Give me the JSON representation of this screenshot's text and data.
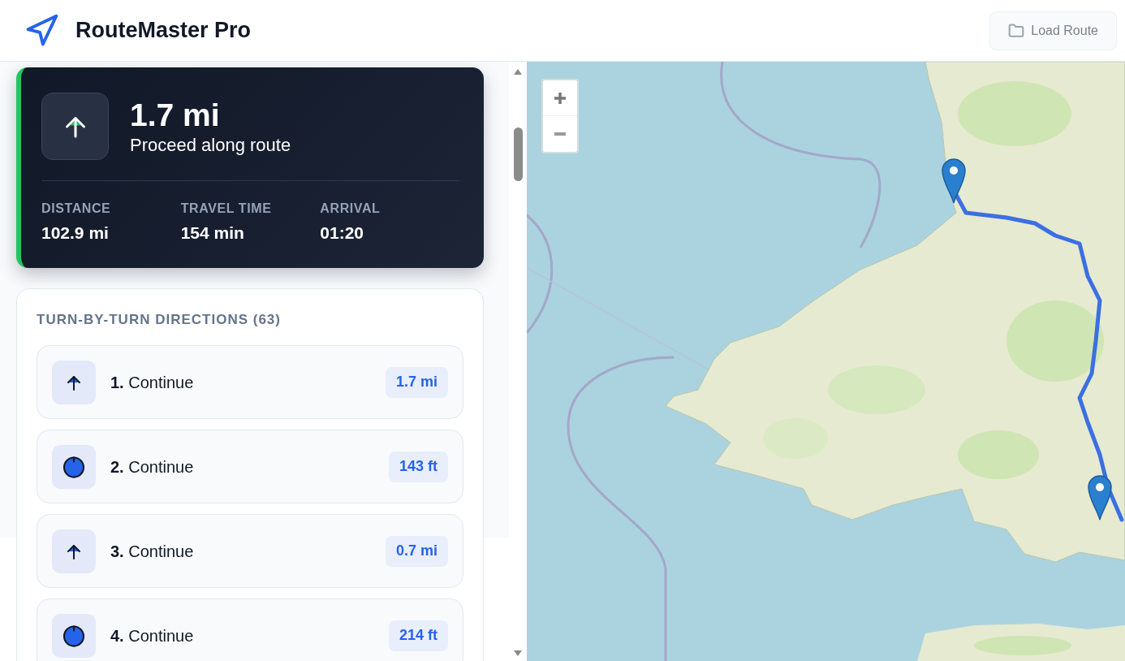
{
  "header": {
    "title": "RouteMaster Pro",
    "load_button": "Load Route"
  },
  "current_step": {
    "distance": "1.7 mi",
    "instruction": "Proceed along route",
    "stats": [
      {
        "label": "DISTANCE",
        "value": "102.9 mi"
      },
      {
        "label": "TRAVEL TIME",
        "value": "154 min"
      },
      {
        "label": "ARRIVAL",
        "value": "01:20"
      }
    ]
  },
  "directions": {
    "title": "TURN-BY-TURN DIRECTIONS (63)",
    "steps": [
      {
        "kind": "arrow",
        "label": "**1.** Continue",
        "distance": "1.7 mi"
      },
      {
        "kind": "circle",
        "label": "**2.** Continue",
        "distance": "143 ft"
      },
      {
        "kind": "arrow",
        "label": "**3.** Continue",
        "distance": "0.7 mi"
      },
      {
        "kind": "circle",
        "label": "**4.** Continue",
        "distance": "214 ft"
      }
    ]
  }
}
